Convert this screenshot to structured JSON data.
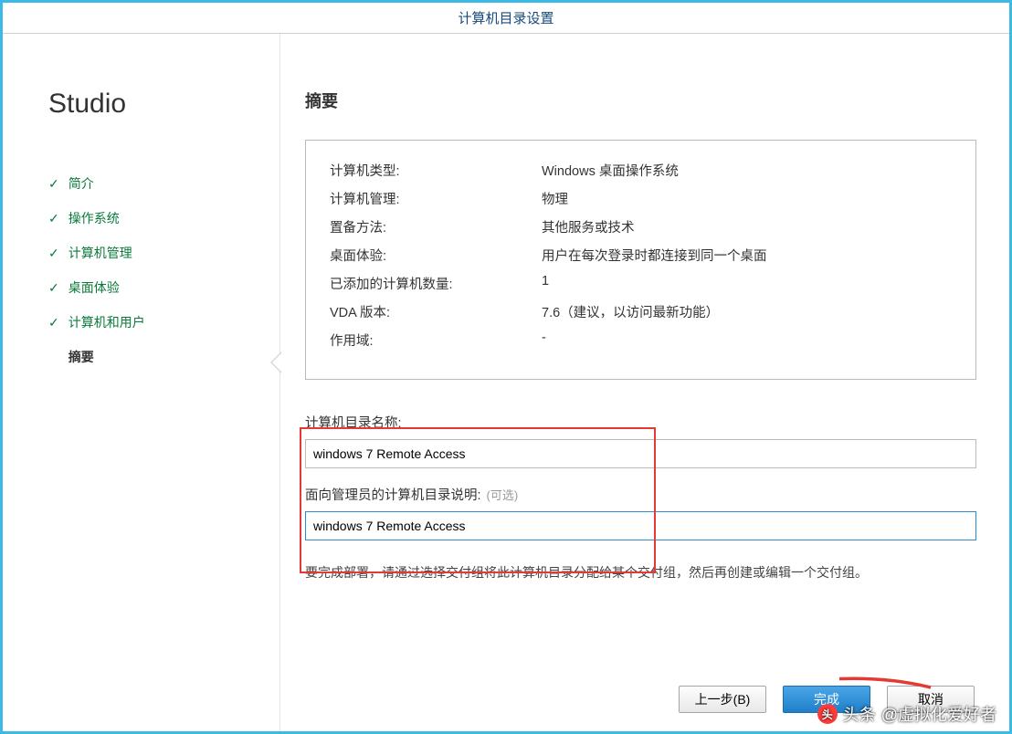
{
  "titlebar": "计算机目录设置",
  "sidebar": {
    "brand": "Studio",
    "steps": [
      {
        "label": "简介",
        "done": true,
        "current": false
      },
      {
        "label": "操作系统",
        "done": true,
        "current": false
      },
      {
        "label": "计算机管理",
        "done": true,
        "current": false
      },
      {
        "label": "桌面体验",
        "done": true,
        "current": false
      },
      {
        "label": "计算机和用户",
        "done": true,
        "current": false
      },
      {
        "label": "摘要",
        "done": false,
        "current": true
      }
    ]
  },
  "main": {
    "title": "摘要",
    "summary": [
      {
        "k": "计算机类型:",
        "v": "Windows 桌面操作系统"
      },
      {
        "k": "计算机管理:",
        "v": "物理"
      },
      {
        "k": "置备方法:",
        "v": "其他服务或技术"
      },
      {
        "k": "桌面体验:",
        "v": "用户在每次登录时都连接到同一个桌面"
      },
      {
        "k": "已添加的计算机数量:",
        "v": "1"
      },
      {
        "k": "VDA 版本:",
        "v": "7.6（建议，以访问最新功能）"
      },
      {
        "k": "作用域:",
        "v": "-"
      }
    ],
    "name_label": "计算机目录名称:",
    "name_value": "windows 7 Remote Access",
    "desc_label": "面向管理员的计算机目录说明:",
    "desc_optional": "(可选)",
    "desc_value": "windows 7 Remote Access",
    "hint": "要完成部署，请通过选择交付组将此计算机目录分配给某个交付组，然后再创建或编辑一个交付组。"
  },
  "buttons": {
    "back": "上一步(B)",
    "finish": "完成",
    "cancel": "取消"
  },
  "watermark": {
    "prefix": "头条",
    "handle": "@虚拟化爱好者"
  }
}
